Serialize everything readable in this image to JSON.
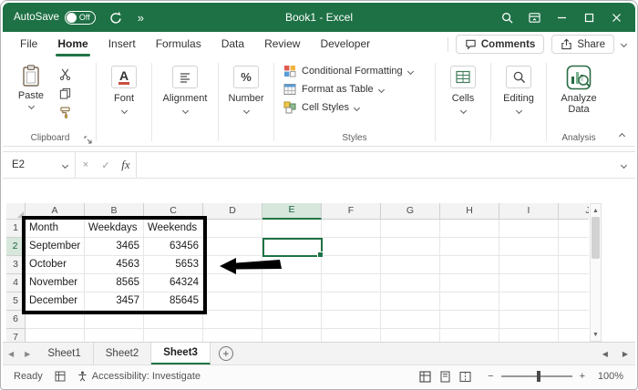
{
  "colors": {
    "accent": "#217346",
    "titlebar_green": "#1e7145",
    "range_border": "#000000",
    "active_cell_border": "#1f7245"
  },
  "titlebar": {
    "autosave_label": "AutoSave",
    "autosave_state": "Off",
    "title": "Book1 - Excel"
  },
  "ribbon": {
    "tabs": [
      "File",
      "Home",
      "Insert",
      "Formulas",
      "Data",
      "Review",
      "Developer"
    ],
    "active_tab": "Home",
    "comments_label": "Comments",
    "share_label": "Share",
    "clipboard": {
      "paste": "Paste",
      "label": "Clipboard"
    },
    "font": {
      "label": "Font",
      "icon_glyph": "A"
    },
    "alignment": {
      "label": "Alignment"
    },
    "number": {
      "label": "Number",
      "icon_glyph": "%"
    },
    "styles": {
      "items": [
        "Conditional Formatting",
        "Format as Table",
        "Cell Styles"
      ],
      "label": "Styles"
    },
    "cells": {
      "label": "Cells"
    },
    "editing": {
      "label": "Editing"
    },
    "analysis": {
      "button": "Analyze Data",
      "label": "Analysis"
    }
  },
  "formula_bar": {
    "name_box": "E2",
    "fx_label": "fx",
    "value": ""
  },
  "grid": {
    "columns": [
      "A",
      "B",
      "C",
      "D",
      "E",
      "F",
      "G",
      "H",
      "I",
      "J"
    ],
    "rows": [
      "1",
      "2",
      "3",
      "4",
      "5",
      "6",
      "7"
    ],
    "active_cell": "E2",
    "cells": [
      [
        "Month",
        "Weekdays",
        "Weekends"
      ],
      [
        "September",
        "3465",
        "63456"
      ],
      [
        "October",
        "4563",
        "5653"
      ],
      [
        "November",
        "8565",
        "64324"
      ],
      [
        "December",
        "3457",
        "85645"
      ]
    ]
  },
  "sheets": {
    "tabs": [
      "Sheet1",
      "Sheet2",
      "Sheet3"
    ],
    "active": "Sheet3"
  },
  "status_bar": {
    "mode": "Ready",
    "accessibility": "Accessibility: Investigate",
    "zoom_level": "100%"
  },
  "glyphs": {
    "more": "»",
    "cancel": "×",
    "enter": "✓",
    "left": "◀",
    "right": "▶",
    "up": "▲",
    "down": "▼",
    "plus": "+",
    "minus": "−",
    "add": "+"
  }
}
